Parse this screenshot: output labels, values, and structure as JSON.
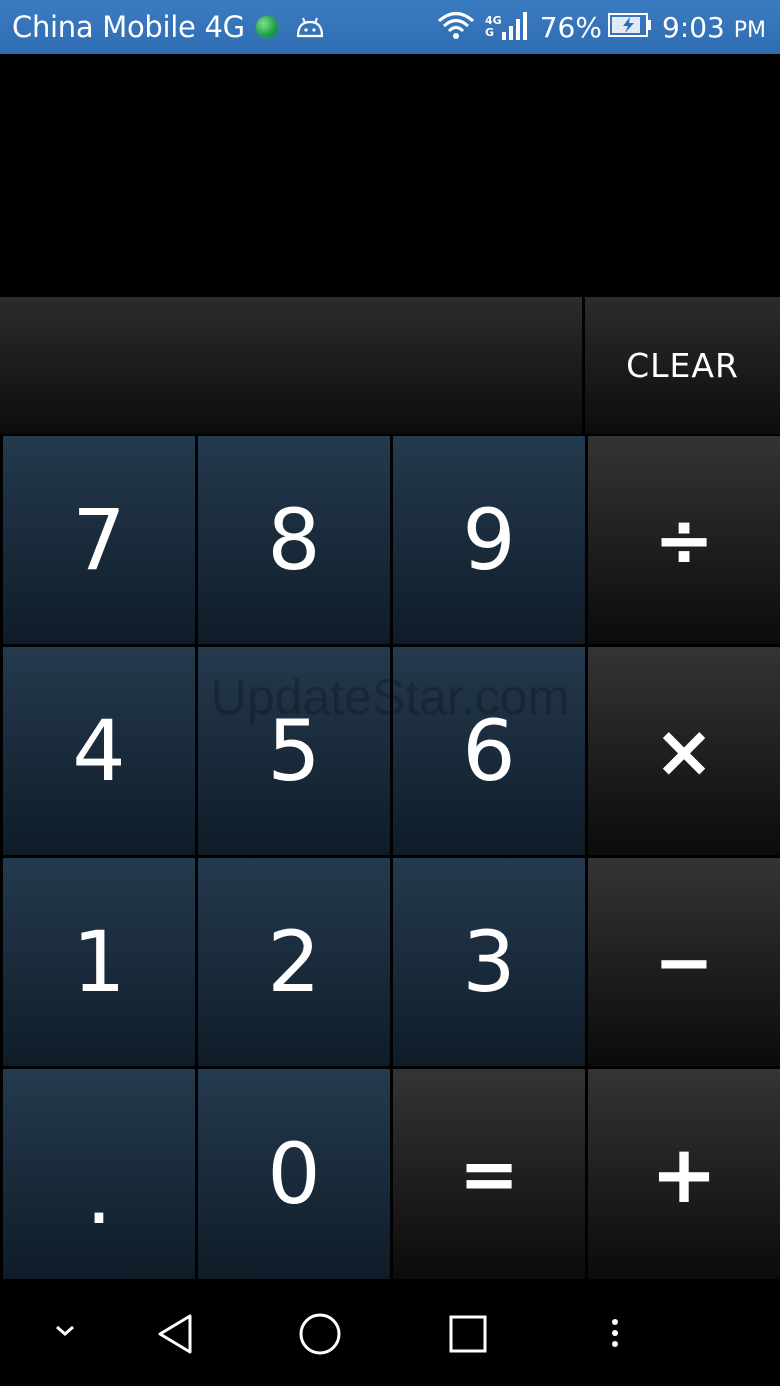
{
  "status_bar": {
    "carrier": "China Mobile 4G",
    "network_top": "4G",
    "network_bottom": "G",
    "battery": "76%",
    "time": "9:03",
    "ampm": "PM"
  },
  "calculator": {
    "clear_label": "CLEAR",
    "keys": {
      "k7": "7",
      "k8": "8",
      "k9": "9",
      "div": "÷",
      "k4": "4",
      "k5": "5",
      "k6": "6",
      "mul": "×",
      "k1": "1",
      "k2": "2",
      "k3": "3",
      "sub": "−",
      "dot": ".",
      "k0": "0",
      "eq": "=",
      "add": "+"
    }
  },
  "watermark": "UpdateStar.com",
  "colors": {
    "status_bar": "#2f6db3",
    "number_key": "#1a2d3e",
    "operator_key": "#1e1e1e"
  }
}
